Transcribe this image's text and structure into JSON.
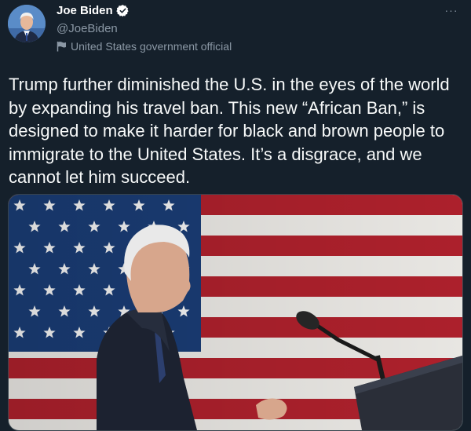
{
  "tweet": {
    "author": {
      "display_name": "Joe Biden",
      "handle": "@JoeBiden",
      "verified": true,
      "label": "United States government official"
    },
    "text": "Trump further diminished the U.S. in the eyes of the world by expanding his travel ban. This new “African Ban,” is designed to make it harder for black and brown people to immigrate to the United States. It’s a disgrace, and we cannot let him succeed.",
    "more_icon": "···"
  },
  "icons": {
    "verified": "verified-badge-icon",
    "government": "flag-icon",
    "more": "more-options-icon"
  },
  "colors": {
    "background": "#15202b",
    "verified_badge": "#ffffff",
    "secondary_text": "#8b98a5",
    "flag_red": "#b5222e",
    "flag_blue": "#1b3f7a"
  }
}
